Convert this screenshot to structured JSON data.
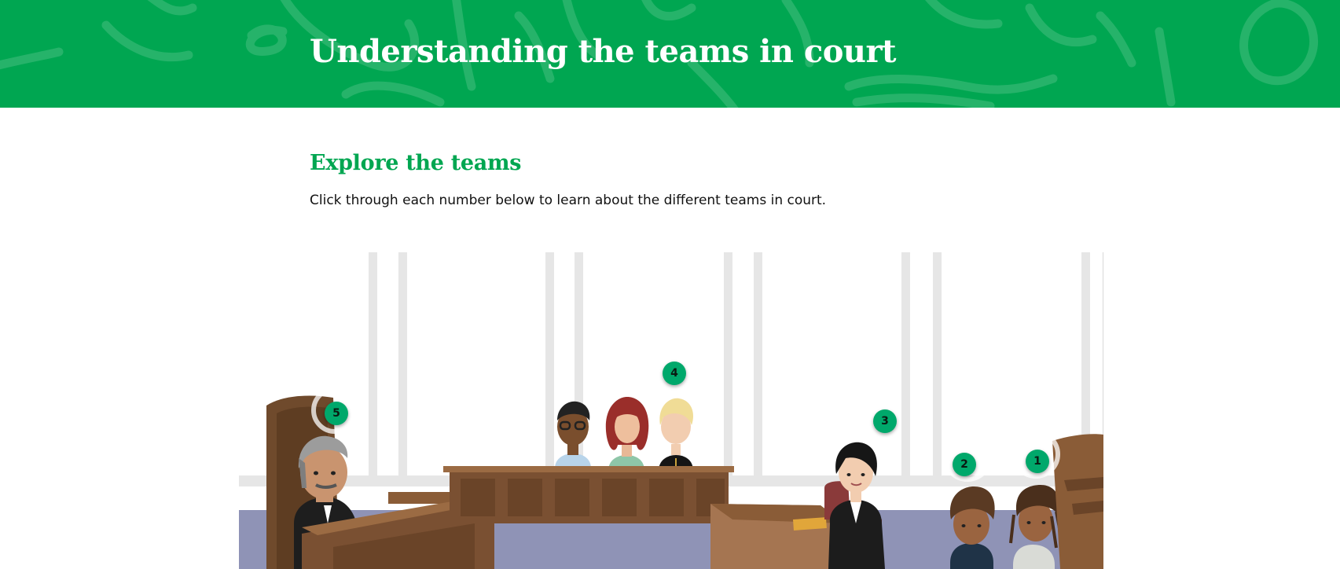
{
  "header": {
    "title": "Understanding the teams in court",
    "background_color": "#00a651"
  },
  "main": {
    "heading": "Explore the teams",
    "intro": "Click through each number below to learn about the different teams in court."
  },
  "courtroom": {
    "hotspots": [
      {
        "label": "1"
      },
      {
        "label": "2"
      },
      {
        "label": "3"
      },
      {
        "label": "4"
      },
      {
        "label": "5"
      }
    ],
    "accent_color": "#00a86b"
  }
}
